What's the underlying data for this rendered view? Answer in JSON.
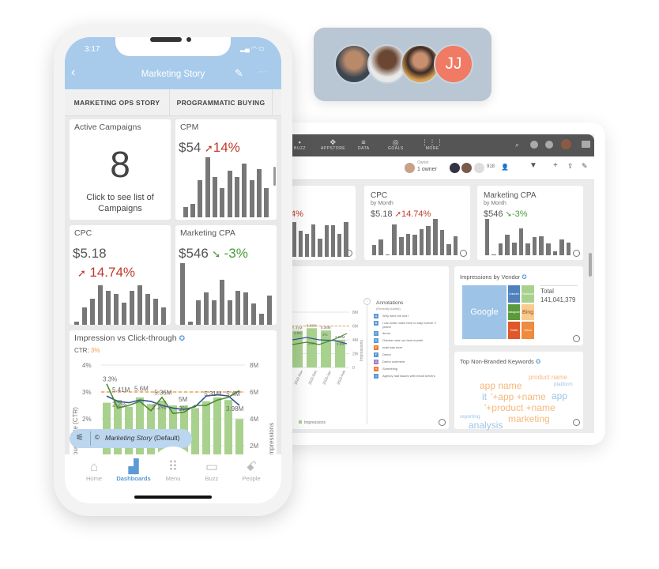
{
  "collaborators": {
    "initials": "JJ",
    "initials_color": "#f07a63"
  },
  "tablet": {
    "nav": [
      {
        "icon": "buzz-icon",
        "label": "BUZZ"
      },
      {
        "icon": "appstore-icon",
        "label": "APPSTORE"
      },
      {
        "icon": "data-icon",
        "label": "DATA"
      },
      {
        "icon": "goals-icon",
        "label": "GOALS"
      },
      {
        "icon": "more-icon",
        "label": "MORE"
      }
    ],
    "owner_label": "Owner",
    "owner_value": "1 owner",
    "viewer_count": "918",
    "partial_card": {
      "delta": "4%",
      "bars": [
        32,
        24,
        21,
        30,
        17,
        29,
        29,
        21,
        32
      ]
    },
    "cpc": {
      "title": "CPC",
      "subtitle": "by Month",
      "value": "$5.18",
      "delta": "14.74%",
      "bars": [
        12,
        18,
        1,
        36,
        21,
        25,
        24,
        30,
        34,
        42,
        29,
        13,
        22
      ]
    },
    "cpa": {
      "title": "Marketing CPA",
      "subtitle": "by Month",
      "value": "$546",
      "delta": "-3%",
      "bars": [
        42,
        1,
        14,
        24,
        15,
        31,
        14,
        21,
        22,
        14,
        5,
        18,
        15
      ]
    },
    "impressions_chart": {
      "y_ticks": [
        "8M",
        "6M",
        "4M",
        "2M",
        "0"
      ],
      "y_label": "Impressions",
      "x_ticks": [
        "2022-Nov",
        "2022-Dec",
        "2023-Jan",
        "2023-Feb"
      ],
      "bars": [
        5.31,
        5.68,
        5.36,
        3.98
      ],
      "bar_labels": [
        "5.31M",
        "5.68M",
        "5.36M",
        "3.98M"
      ],
      "ctr_labels": [
        "2.9%",
        "2.5%",
        "3%",
        "2.5%"
      ],
      "legend": "Impressions"
    },
    "annotations": {
      "title": "Annotations",
      "subtitle": "(Recently Added)",
      "items": [
        {
          "key": "A",
          "text": "Why were we low?",
          "color": "#5b9bd5"
        },
        {
          "key": "B",
          "text": "I can write notes here to stay forever 2 years!",
          "color": "#5b9bd5"
        },
        {
          "key": "C",
          "text": "demo",
          "color": "#5b9bd5"
        },
        {
          "key": "D",
          "text": "October was our best month!",
          "color": "#5b9bd5"
        },
        {
          "key": "E",
          "text": "matt was here",
          "color": "#ed7d31"
        },
        {
          "key": "F",
          "text": "Demo",
          "color": "#5b9bd5"
        },
        {
          "key": "G",
          "text": "Demo comment",
          "color": "#9b7fc4"
        },
        {
          "key": "H",
          "text": "Something",
          "color": "#ed7d31"
        },
        {
          "key": "I",
          "text": "Agency had issues with email servers",
          "color": "#5b9bd5"
        }
      ]
    },
    "vendor": {
      "title": "Impressions by Vendor",
      "total_label": "Total",
      "total_value": "141,041,379",
      "cells": [
        {
          "name": "Google",
          "color": "#9dc3e6"
        },
        {
          "name": "LinkedIn",
          "color": "#4f81bd"
        },
        {
          "name": "Facebook",
          "color": "#a9d18e"
        },
        {
          "name": "Instagram",
          "color": "#5a9a3c"
        },
        {
          "name": "Bing",
          "color": "#f8cb8f"
        },
        {
          "name": "Twitter",
          "color": "#e0572a"
        },
        {
          "name": "Yahoo",
          "color": "#f08a3c"
        }
      ]
    },
    "keywords": {
      "title": "Top Non-Branded Keywords",
      "words": [
        {
          "text": "product name",
          "color": "#f5b87a"
        },
        {
          "text": "app name",
          "color": "#f5b87a"
        },
        {
          "text": "platform",
          "color": "#9dc3e6"
        },
        {
          "text": "it",
          "color": "#9dc3e6"
        },
        {
          "text": "'+app +name",
          "color": "#f5b87a"
        },
        {
          "text": "app",
          "color": "#9dc3e6"
        },
        {
          "text": "'+product +name",
          "color": "#f5b87a"
        },
        {
          "text": "reporting",
          "color": "#9dc3e6"
        },
        {
          "text": "marketing",
          "color": "#f5b87a"
        },
        {
          "text": "analysis",
          "color": "#9dc3e6"
        }
      ]
    }
  },
  "phone": {
    "time": "3:17",
    "title": "Marketing Story",
    "tabs": [
      "MARKETING OPS STORY",
      "PROGRAMMATIC BUYING"
    ],
    "active_campaigns": {
      "title": "Active Campaigns",
      "value": "8",
      "caption": "Click to see list of Campaigns"
    },
    "cpm": {
      "title": "CPM",
      "value": "$54",
      "delta": "14%",
      "bars": [
        8,
        10,
        28,
        45,
        30,
        22,
        35,
        30,
        40,
        28,
        36,
        22
      ]
    },
    "cpc": {
      "title": "CPC",
      "value": "$5.18",
      "delta": "14.74%",
      "bars": [
        4,
        20,
        30,
        46,
        40,
        36,
        26,
        40,
        46,
        36,
        30,
        20
      ]
    },
    "cpa": {
      "title": "Marketing CPA",
      "value": "$546",
      "delta": "-3%",
      "bars": [
        76,
        4,
        30,
        40,
        30,
        56,
        30,
        42,
        40,
        26,
        14,
        36
      ]
    },
    "impression_chart": {
      "title": "Impression vs Click-through",
      "ctr_label": "CTR:",
      "ctr_value": "3%",
      "y_left_ticks": [
        "4%",
        "3%",
        "2%"
      ],
      "y_right_ticks": [
        "8M",
        "6M",
        "4M",
        "2M"
      ],
      "y_left_label": "Through Rate (CTR)",
      "y_right_label": "Impressions",
      "bars": [
        5.2,
        5.41,
        4.9,
        5.6,
        5.1,
        5.36,
        5.0,
        5.0,
        4.8,
        5.31,
        5.6,
        5.4,
        3.98
      ],
      "labels": [
        "3.3%",
        "5.41M",
        "2.2%",
        "5.6M",
        "5.36M",
        "2.2%",
        "5M",
        "2%",
        "5.31M",
        "5.4M",
        "3.98M"
      ]
    },
    "story_chip": {
      "name": "Marketing Story",
      "suffix": "(Default)"
    },
    "nav": [
      {
        "label": "Home",
        "icon": "home-icon"
      },
      {
        "label": "Dashboards",
        "icon": "dashboards-icon",
        "active": true
      },
      {
        "label": "Menu",
        "icon": "menu-grid-icon"
      },
      {
        "label": "Buzz",
        "icon": "buzz-icon"
      },
      {
        "label": "People",
        "icon": "people-icon"
      }
    ]
  }
}
